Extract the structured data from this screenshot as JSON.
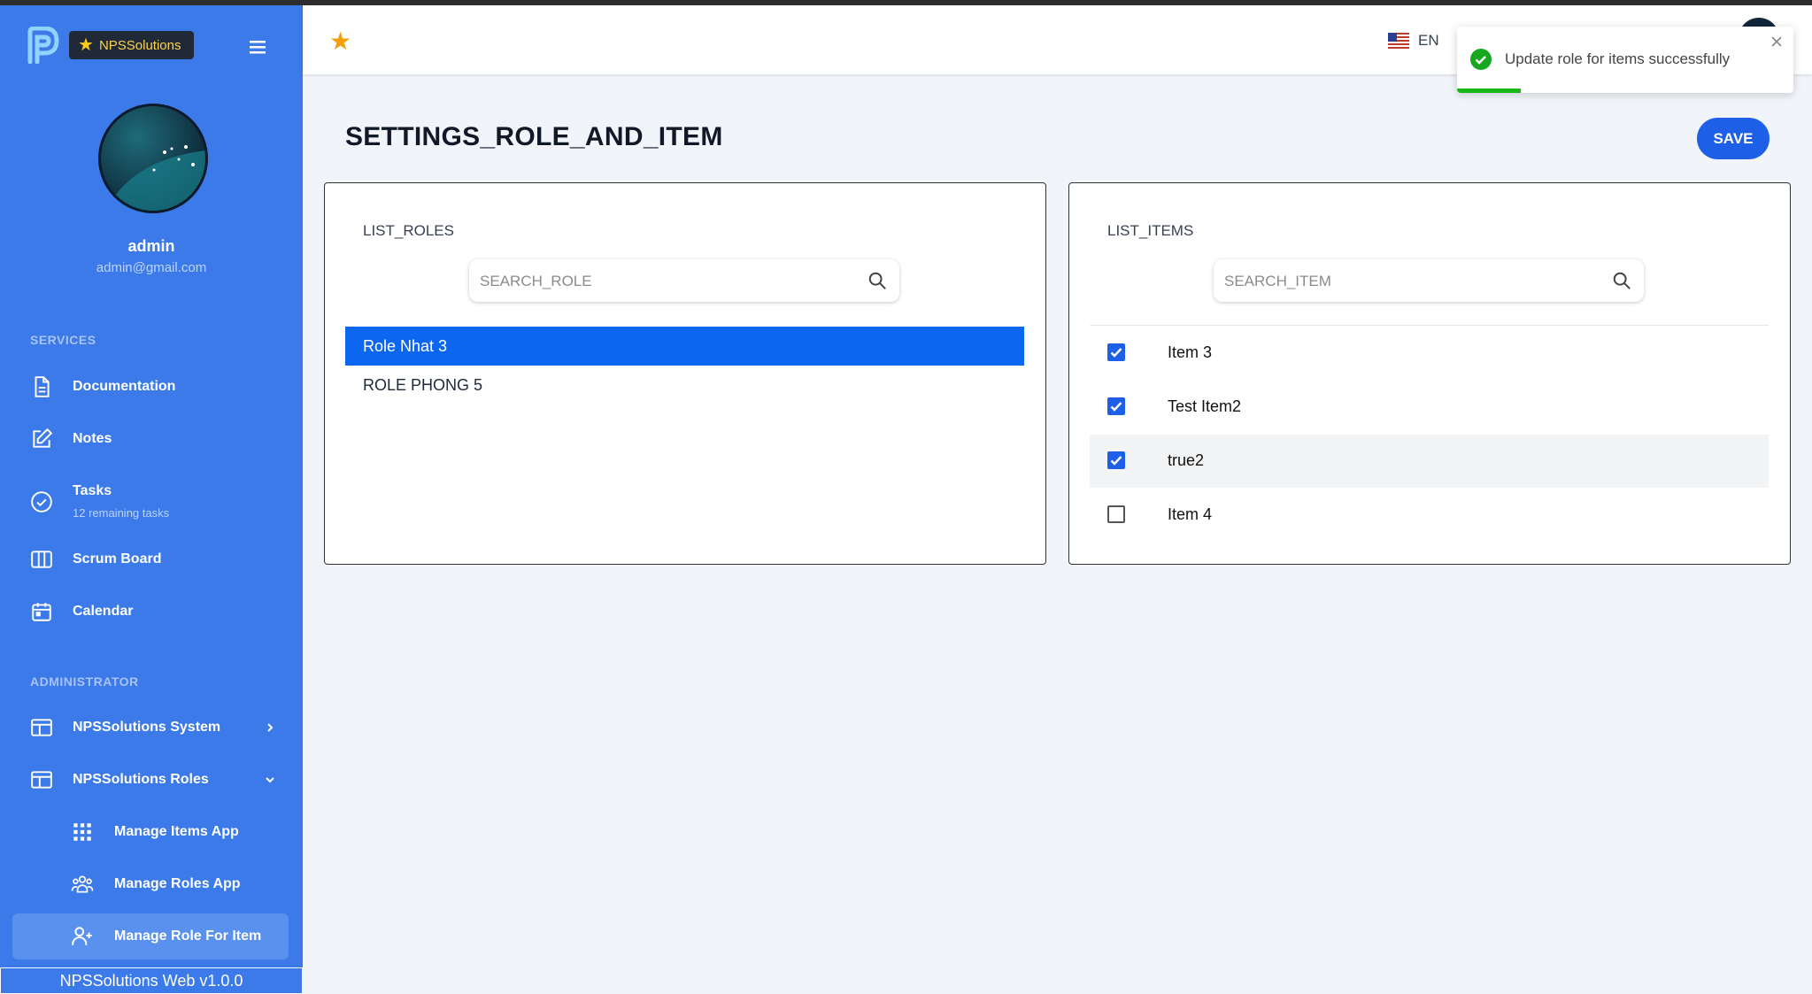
{
  "sidebar": {
    "brand": "NPSSolutions",
    "user": {
      "name": "admin",
      "email": "admin@gmail.com"
    },
    "sections": {
      "services": "SERVICES",
      "administrator": "ADMINISTRATOR"
    },
    "items": [
      {
        "label": "Documentation",
        "icon": "document-icon"
      },
      {
        "label": "Notes",
        "icon": "pencil-square-icon"
      },
      {
        "label": "Tasks",
        "sublabel": "12 remaining tasks",
        "icon": "check-circle-icon"
      },
      {
        "label": "Scrum Board",
        "icon": "columns-icon"
      },
      {
        "label": "Calendar",
        "icon": "calendar-icon"
      },
      {
        "label": "NPSSolutions System",
        "icon": "window-icon"
      },
      {
        "label": "NPSSolutions Roles",
        "icon": "window-icon"
      },
      {
        "label": "Manage Items App",
        "icon": "grid-icon"
      },
      {
        "label": "Manage Roles App",
        "icon": "users-icon"
      },
      {
        "label": "Manage Role For Item",
        "icon": "user-plus-icon"
      }
    ],
    "version": "NPSSolutions Web v1.0.0"
  },
  "header": {
    "language": "EN"
  },
  "toast": {
    "message": "Update role for items successfully",
    "progress": 0.19
  },
  "main": {
    "title": "SETTINGS_ROLE_AND_ITEM",
    "save_label": "SAVE",
    "roles": {
      "label": "LIST_ROLES",
      "search_placeholder": "SEARCH_ROLE",
      "list": [
        "Role Nhat 3",
        "ROLE PHONG 5"
      ],
      "selected": 0
    },
    "items": {
      "label": "LIST_ITEMS",
      "search_placeholder": "SEARCH_ITEM",
      "list": [
        {
          "label": "Item 3",
          "checked": true
        },
        {
          "label": "Test Item2",
          "checked": true
        },
        {
          "label": "true2",
          "checked": true
        },
        {
          "label": "Item 4",
          "checked": false
        }
      ]
    }
  },
  "colors": {
    "sidebar": "#3b7ae8",
    "accent": "#1d5fe6",
    "success": "#1ab61a"
  }
}
